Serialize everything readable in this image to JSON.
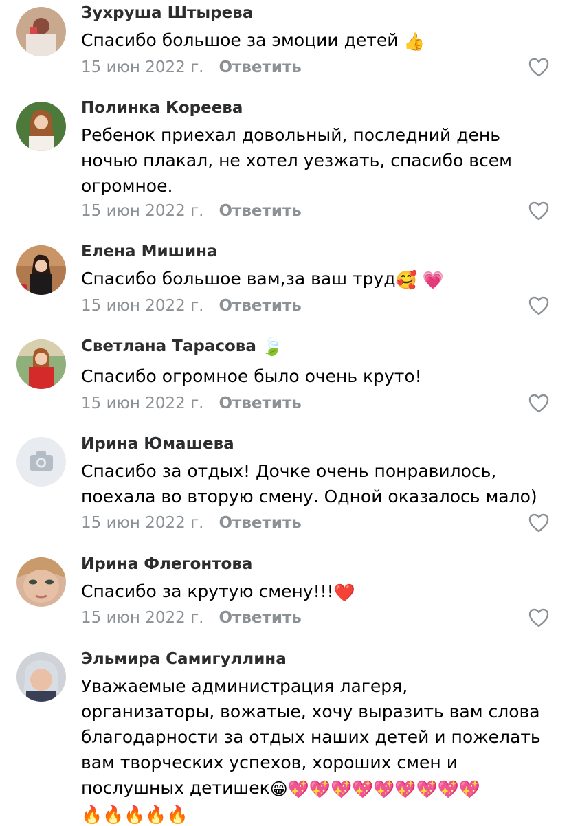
{
  "comments": [
    {
      "name": "Зухруша Штырева",
      "text": "Спасибо большое за эмоции детей",
      "emoji": "👍",
      "date": "15 июн 2022 г.",
      "reply": "Ответить"
    },
    {
      "name": "Полинка Кореева",
      "lines": [
        "Ребенок приехал довольный, последний день",
        "ночью плакал, не хотел уезжать, спасибо  всем",
        "огромное."
      ],
      "date": "15 июн 2022 г.",
      "reply": "Ответить"
    },
    {
      "name": "Елена Мишина",
      "text": "Спасибо большое вам,за ваш труд",
      "emoji": "🥰 💗",
      "date": "15 июн 2022 г.",
      "reply": "Ответить"
    },
    {
      "name": "Светлана Тарасова",
      "name_emoji": "🍃",
      "text": "Спасибо огромное было очень круто!",
      "date": "15 июн 2022 г.",
      "reply": "Ответить"
    },
    {
      "name": "Ирина Юмашева",
      "lines": [
        "Спасибо за отдых! Дочке очень понравилось,",
        "поехала во вторую смену. Одной оказалось мало)"
      ],
      "date": "15 июн 2022 г.",
      "reply": "Ответить"
    },
    {
      "name": "Ирина Флегонтова",
      "text": "Спасибо за крутую смену!!!",
      "emoji": "❤️",
      "date": "15 июн 2022 г.",
      "reply": "Ответить"
    },
    {
      "name": "Эльмира Самигуллина",
      "lines": [
        "Уважаемые администрация лагеря,",
        "организаторы, вожатые, хочу выразить вам слова",
        "благодарности за отдых наших детей и пожелать",
        "вам творческих успехов, хороших смен и",
        "послушных детишек"
      ],
      "emoji": "😁💖💖💖💖💖💖💖💖💖",
      "emoji2": "🔥🔥🔥🔥🔥"
    }
  ],
  "icons": {
    "like": "heart-outline-icon",
    "placeholder": "camera-icon"
  },
  "colors": {
    "name": "#2c2d2e",
    "meta": "#8c9196",
    "placeholder_bg": "#e8ecf0",
    "placeholder_icon": "#b4bcc6"
  }
}
